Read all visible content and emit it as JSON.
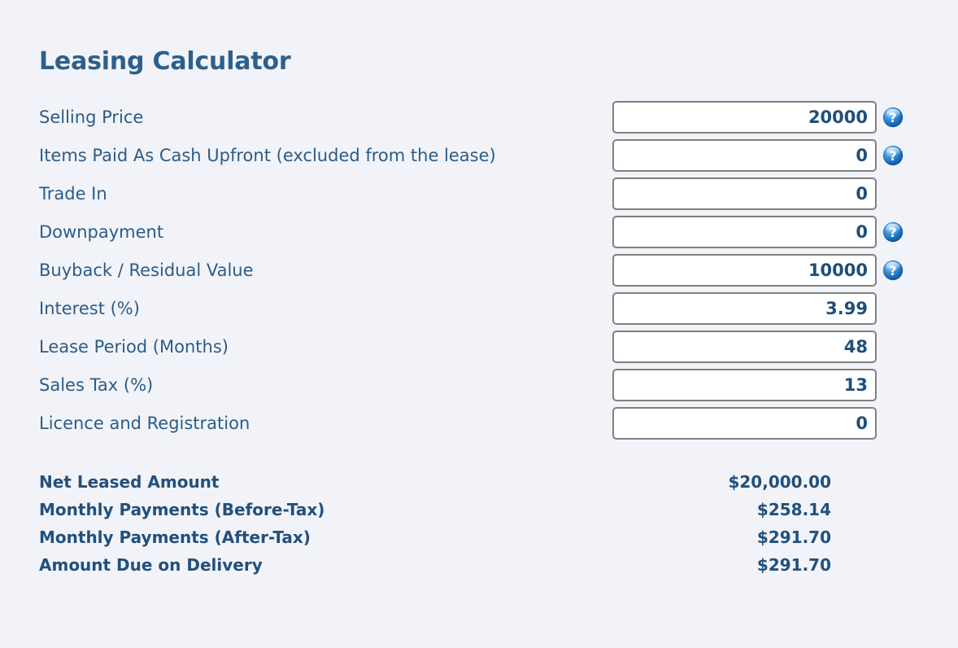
{
  "app": {
    "title": "Leasing Calculator",
    "background_color": "#f2f3f8",
    "accent_color": "#2d5f8b",
    "label_color": "#2b5c89",
    "value_color": "#1f4e79"
  },
  "form": {
    "rows": [
      {
        "label": "Selling Price",
        "value": "20000",
        "placeholder": "",
        "has_help": true,
        "help_icon": "help-circle-icon"
      },
      {
        "label": "Items Paid As Cash Upfront (excluded from the lease)",
        "value": "0",
        "placeholder": "",
        "has_help": true,
        "help_icon": "help-circle-icon"
      },
      {
        "label": "Trade In",
        "value": "0",
        "placeholder": "",
        "has_help": false,
        "help_icon": ""
      },
      {
        "label": "Downpayment",
        "value": "0",
        "placeholder": "",
        "has_help": true,
        "help_icon": "help-circle-icon"
      },
      {
        "label": "Buyback / Residual Value",
        "value": "10000",
        "placeholder": "",
        "has_help": true,
        "help_icon": "help-circle-icon"
      },
      {
        "label": "Interest (%)",
        "value": "3.99",
        "placeholder": "",
        "has_help": false,
        "help_icon": ""
      },
      {
        "label": "Lease Period (Months)",
        "value": "48",
        "placeholder": "",
        "has_help": false,
        "help_icon": ""
      },
      {
        "label": "Sales Tax (%)",
        "value": "13",
        "placeholder": "",
        "has_help": false,
        "help_icon": ""
      },
      {
        "label": "Licence and Registration",
        "value": "0",
        "placeholder": "",
        "has_help": false,
        "help_icon": ""
      }
    ]
  },
  "results": {
    "rows": [
      {
        "label": "Net Leased Amount",
        "value": "$20,000.00"
      },
      {
        "label": "Monthly Payments (Before-Tax)",
        "value": "$258.14"
      },
      {
        "label": "Monthly Payments (After-Tax)",
        "value": "$291.70"
      },
      {
        "label": "Amount Due on Delivery",
        "value": "$291.70"
      }
    ]
  }
}
